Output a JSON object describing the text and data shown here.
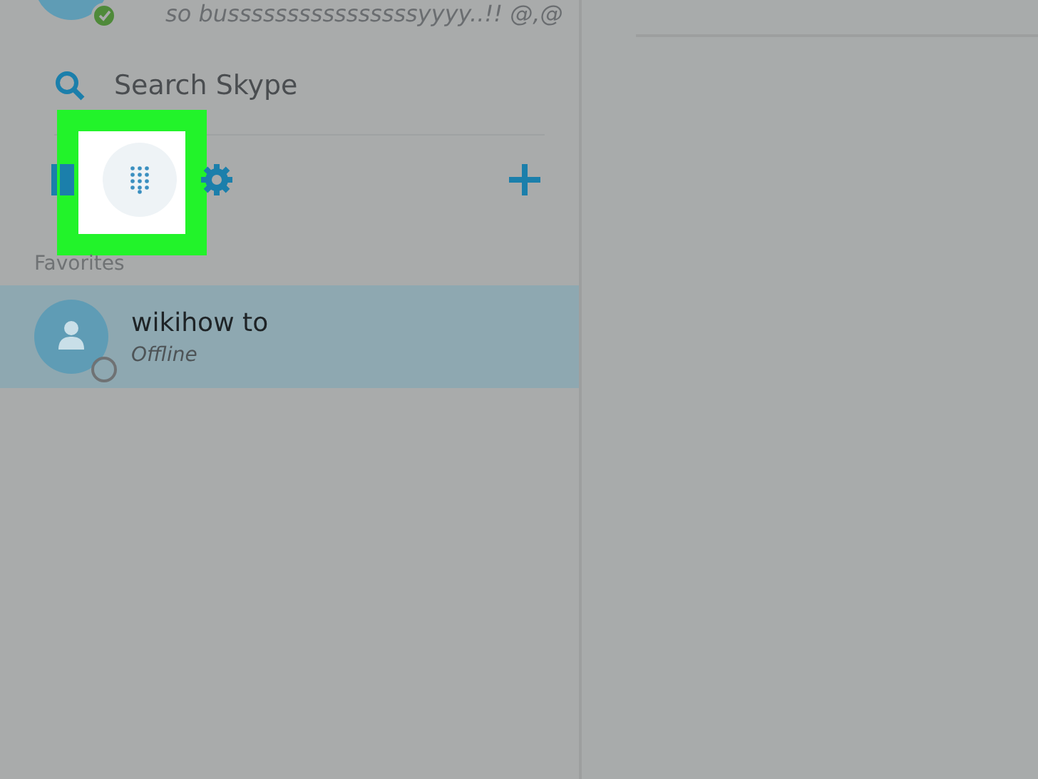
{
  "profile": {
    "mood": "so bussssssssssssssssyyyy..!! @,@",
    "online": true
  },
  "search": {
    "placeholder": "Search Skype"
  },
  "toolbar": {
    "dialpad_highlighted": true
  },
  "favorites": {
    "heading": "Favorites",
    "contacts": [
      {
        "name": "wikihow to",
        "status": "Offline",
        "selected": true,
        "online": false
      }
    ]
  }
}
